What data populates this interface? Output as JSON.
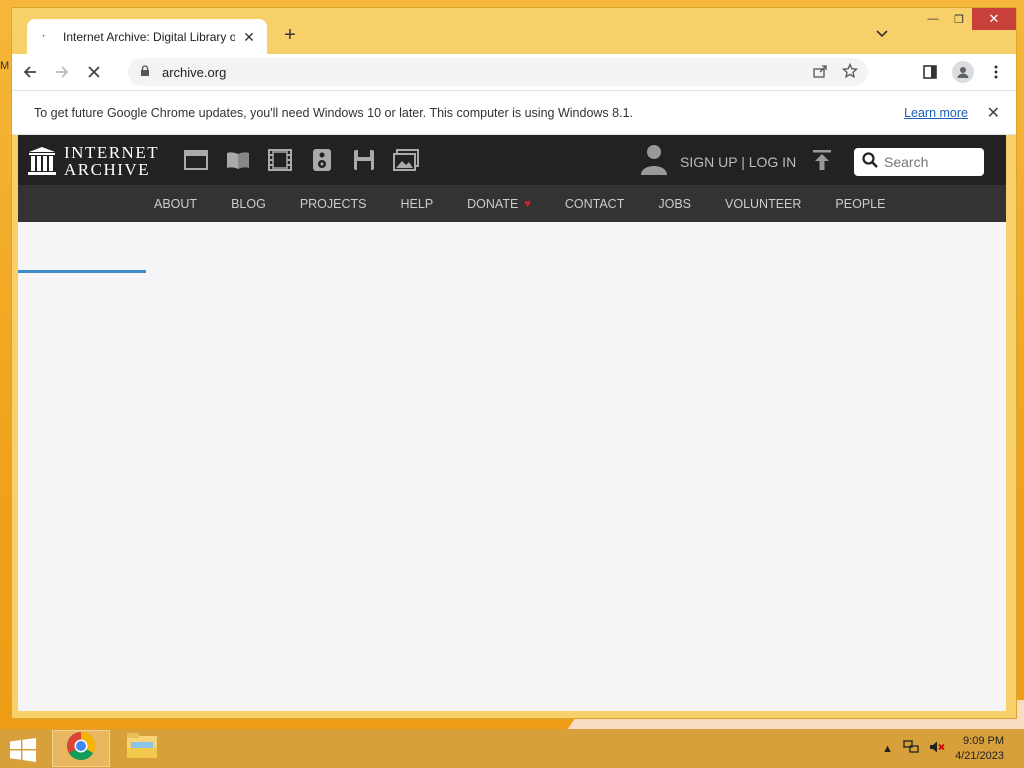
{
  "desktop": {
    "edge_glyph": "M"
  },
  "browser": {
    "tab": {
      "title": "Internet Archive: Digital Library of Free & Borrowable Books, Movies, Music & Wayback Machine",
      "close": "✕"
    },
    "new_tab": "+",
    "window_controls": {
      "minimize": "—",
      "maximize": "❐",
      "close": "✕"
    },
    "address": {
      "url": "archive.org"
    },
    "infobar": {
      "message": "To get future Google Chrome updates, you'll need Windows 10 or later. This computer is using Windows 8.1.",
      "link": "Learn more",
      "close": "✕"
    }
  },
  "site": {
    "logo": {
      "line1": "INTERNET",
      "line2": "ARCHIVE"
    },
    "media_icons": [
      "web-icon",
      "texts-icon",
      "video-icon",
      "audio-icon",
      "software-icon",
      "images-icon"
    ],
    "account": "SIGN UP | LOG IN",
    "search": {
      "placeholder": "Search"
    },
    "nav": [
      "ABOUT",
      "BLOG",
      "PROJECTS",
      "HELP",
      "DONATE",
      "CONTACT",
      "JOBS",
      "VOLUNTEER",
      "PEOPLE"
    ],
    "loading_progress": 0.13
  },
  "taskbar": {
    "time": "9:09 PM",
    "date": "4/21/2023"
  },
  "colors": {
    "ia_header": "#222222",
    "ia_nav": "#333333",
    "progress": "#428bca",
    "donate_heart": "#e02020"
  }
}
